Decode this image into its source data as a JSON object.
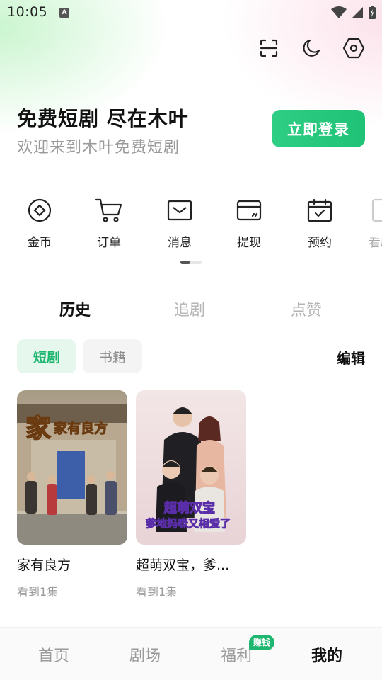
{
  "status": {
    "time": "10:05"
  },
  "header": {
    "icons": [
      "scan-icon",
      "moon-icon",
      "settings-hexagon-icon"
    ]
  },
  "hero": {
    "title": "免费短剧 尽在木叶",
    "subtitle": "欢迎来到木叶免费短剧",
    "login_label": "立即登录"
  },
  "quick_menu": {
    "items": [
      {
        "label": "金币",
        "icon": "coin-icon"
      },
      {
        "label": "订单",
        "icon": "cart-icon"
      },
      {
        "label": "消息",
        "icon": "mail-icon"
      },
      {
        "label": "提现",
        "icon": "wallet-icon"
      },
      {
        "label": "预约",
        "icon": "calendar-icon"
      },
      {
        "label": "看剧",
        "icon": "phone-icon"
      }
    ]
  },
  "tabs": {
    "items": [
      "历史",
      "追剧",
      "点赞"
    ],
    "active": "历史"
  },
  "sub_tabs": {
    "items": [
      "短剧",
      "书籍"
    ],
    "active": "短剧",
    "edit_label": "编辑"
  },
  "cards": [
    {
      "title": "家有良方",
      "progress": "看到1集",
      "cover_text": "家有良方"
    },
    {
      "title": "超萌双宝，爹...",
      "progress": "看到1集",
      "cover_text_1": "超萌双宝",
      "cover_text_2": "爹地妈咪又相爱了"
    }
  ],
  "bottom_nav": {
    "items": [
      "首页",
      "剧场",
      "福利",
      "我的"
    ],
    "active": "我的",
    "badge": "赚钱"
  },
  "colors": {
    "accent": "#1fc276",
    "accent_light": "#e6f7ee"
  }
}
